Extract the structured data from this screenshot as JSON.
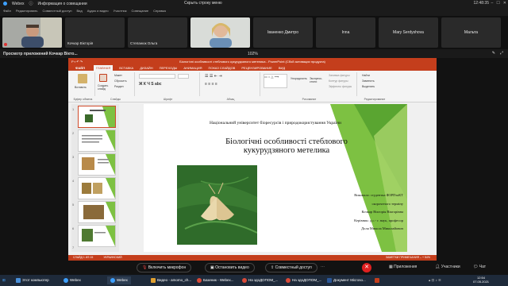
{
  "webex": {
    "app_name": "Webex",
    "meeting_info": "Информация о совещании",
    "hide_menu": "Скрыть строку меню",
    "menu": [
      "Файл",
      "Редактировать",
      "Совместный доступ",
      "Вид",
      "Аудио и видео",
      "Участник",
      "Совещание",
      "Справка"
    ],
    "clock": "12:48:35"
  },
  "participants": [
    {
      "name": "",
      "has_video": true,
      "kind": "man"
    },
    {
      "name": "Кочкар Вікторія",
      "has_video": false
    },
    {
      "name": "Степанюк Ольга",
      "has_video": false
    },
    {
      "name": "",
      "has_video": true,
      "kind": "woman"
    },
    {
      "name": "Іваненко Дмитро",
      "has_video": false
    },
    {
      "name": "Inna",
      "has_video": false
    },
    {
      "name": "Mary Serdyshova",
      "has_video": false
    },
    {
      "name": "Мальта",
      "has_video": false
    }
  ],
  "viewing": {
    "title": "Просмотр приложений Кочкар Вікто...",
    "zoom": "102%"
  },
  "powerpoint": {
    "window_title": "Біологічні особливості стеблового кукурудзяного метелика - PowerPoint (Сбой активации продукта)",
    "tabs": [
      "ФАЙЛ",
      "ГЛАВНАЯ",
      "ВСТАВКА",
      "ДИЗАЙН",
      "ПЕРЕХОДЫ",
      "АНИМАЦИЯ",
      "ПОКАЗ СЛАЙДОВ",
      "РЕЦЕНЗИРОВАНИЕ",
      "ВИД"
    ],
    "ribbon_groups": [
      "Буфер обмена",
      "Слайды",
      "Шрифт",
      "Абзац",
      "Рисование",
      "Редактирование"
    ],
    "ribbon_buttons": {
      "paste": "Вставить",
      "create_slide": "Создать слайд",
      "layout": "Макет",
      "reset": "Сбросить",
      "section": "Раздел",
      "arrange": "Упорядочить",
      "quick_styles": "Экспресс-стили",
      "fill": "Заливка фигуры",
      "outline": "Контур фигуры",
      "effects": "Эффекты фигуры",
      "find": "Найти",
      "replace": "Заменить",
      "select": "Выделить"
    },
    "slide_numbers": [
      "1",
      "2",
      "3",
      "4",
      "5",
      "6",
      "7"
    ],
    "slide": {
      "university": "Національний університет біоресурсів і природокористування України",
      "title": "Біологічні особливості стеблового кукурудзяного метелика",
      "author_lines": [
        "Виконала: студентка ФЗРПтаКТ",
        "скороченого терміну",
        "Кочкар Вікторія Вікторівна",
        "Керівник: д.с.- г. наук, професор",
        "Доля Микола Миколайович"
      ]
    },
    "status_left": "СЛАЙД 1 ИЗ 15",
    "status_lang": "УКРАИНСКИЙ",
    "status_right": "ЗАМЕТКИ   ПРИМЕЧАНИЯ   –  +  54%"
  },
  "controls": {
    "mic": "Включить микрофон",
    "video": "Остановить видео",
    "share": "Совместный доступ",
    "apps": "Приложения",
    "participants": "Участники",
    "chat": "Чат"
  },
  "taskbar": {
    "items": [
      "Этот компьютер",
      "Webex",
      "Webex",
      "Видео - amomo_ch...",
      "Базеник - Webex...",
      "На здоДОПОМ_...",
      "На здоДОПОМ_...",
      "Документ Microso..."
    ],
    "time": "12:54",
    "date": "07.05.2021"
  },
  "colors": {
    "ppt_accent": "#c43e1c",
    "end_call": "#e02020",
    "slide_green": "#7dc142"
  }
}
